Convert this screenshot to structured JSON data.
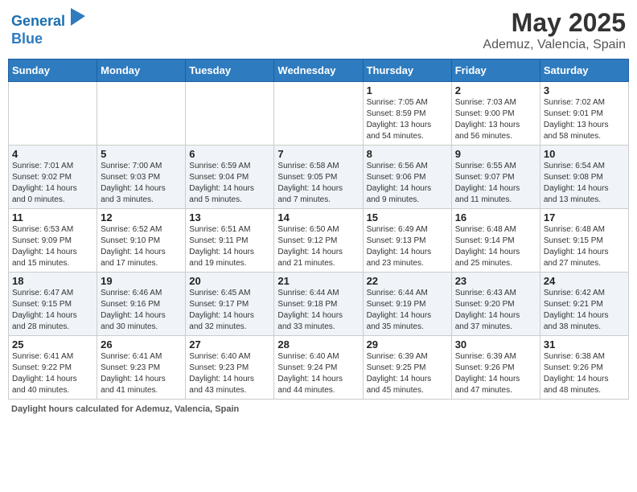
{
  "header": {
    "logo_line1": "General",
    "logo_line2": "Blue",
    "title": "May 2025",
    "subtitle": "Ademuz, Valencia, Spain"
  },
  "days_of_week": [
    "Sunday",
    "Monday",
    "Tuesday",
    "Wednesday",
    "Thursday",
    "Friday",
    "Saturday"
  ],
  "weeks": [
    [
      {
        "day": "",
        "info": ""
      },
      {
        "day": "",
        "info": ""
      },
      {
        "day": "",
        "info": ""
      },
      {
        "day": "",
        "info": ""
      },
      {
        "day": "1",
        "info": "Sunrise: 7:05 AM\nSunset: 8:59 PM\nDaylight: 13 hours\nand 54 minutes."
      },
      {
        "day": "2",
        "info": "Sunrise: 7:03 AM\nSunset: 9:00 PM\nDaylight: 13 hours\nand 56 minutes."
      },
      {
        "day": "3",
        "info": "Sunrise: 7:02 AM\nSunset: 9:01 PM\nDaylight: 13 hours\nand 58 minutes."
      }
    ],
    [
      {
        "day": "4",
        "info": "Sunrise: 7:01 AM\nSunset: 9:02 PM\nDaylight: 14 hours\nand 0 minutes."
      },
      {
        "day": "5",
        "info": "Sunrise: 7:00 AM\nSunset: 9:03 PM\nDaylight: 14 hours\nand 3 minutes."
      },
      {
        "day": "6",
        "info": "Sunrise: 6:59 AM\nSunset: 9:04 PM\nDaylight: 14 hours\nand 5 minutes."
      },
      {
        "day": "7",
        "info": "Sunrise: 6:58 AM\nSunset: 9:05 PM\nDaylight: 14 hours\nand 7 minutes."
      },
      {
        "day": "8",
        "info": "Sunrise: 6:56 AM\nSunset: 9:06 PM\nDaylight: 14 hours\nand 9 minutes."
      },
      {
        "day": "9",
        "info": "Sunrise: 6:55 AM\nSunset: 9:07 PM\nDaylight: 14 hours\nand 11 minutes."
      },
      {
        "day": "10",
        "info": "Sunrise: 6:54 AM\nSunset: 9:08 PM\nDaylight: 14 hours\nand 13 minutes."
      }
    ],
    [
      {
        "day": "11",
        "info": "Sunrise: 6:53 AM\nSunset: 9:09 PM\nDaylight: 14 hours\nand 15 minutes."
      },
      {
        "day": "12",
        "info": "Sunrise: 6:52 AM\nSunset: 9:10 PM\nDaylight: 14 hours\nand 17 minutes."
      },
      {
        "day": "13",
        "info": "Sunrise: 6:51 AM\nSunset: 9:11 PM\nDaylight: 14 hours\nand 19 minutes."
      },
      {
        "day": "14",
        "info": "Sunrise: 6:50 AM\nSunset: 9:12 PM\nDaylight: 14 hours\nand 21 minutes."
      },
      {
        "day": "15",
        "info": "Sunrise: 6:49 AM\nSunset: 9:13 PM\nDaylight: 14 hours\nand 23 minutes."
      },
      {
        "day": "16",
        "info": "Sunrise: 6:48 AM\nSunset: 9:14 PM\nDaylight: 14 hours\nand 25 minutes."
      },
      {
        "day": "17",
        "info": "Sunrise: 6:48 AM\nSunset: 9:15 PM\nDaylight: 14 hours\nand 27 minutes."
      }
    ],
    [
      {
        "day": "18",
        "info": "Sunrise: 6:47 AM\nSunset: 9:15 PM\nDaylight: 14 hours\nand 28 minutes."
      },
      {
        "day": "19",
        "info": "Sunrise: 6:46 AM\nSunset: 9:16 PM\nDaylight: 14 hours\nand 30 minutes."
      },
      {
        "day": "20",
        "info": "Sunrise: 6:45 AM\nSunset: 9:17 PM\nDaylight: 14 hours\nand 32 minutes."
      },
      {
        "day": "21",
        "info": "Sunrise: 6:44 AM\nSunset: 9:18 PM\nDaylight: 14 hours\nand 33 minutes."
      },
      {
        "day": "22",
        "info": "Sunrise: 6:44 AM\nSunset: 9:19 PM\nDaylight: 14 hours\nand 35 minutes."
      },
      {
        "day": "23",
        "info": "Sunrise: 6:43 AM\nSunset: 9:20 PM\nDaylight: 14 hours\nand 37 minutes."
      },
      {
        "day": "24",
        "info": "Sunrise: 6:42 AM\nSunset: 9:21 PM\nDaylight: 14 hours\nand 38 minutes."
      }
    ],
    [
      {
        "day": "25",
        "info": "Sunrise: 6:41 AM\nSunset: 9:22 PM\nDaylight: 14 hours\nand 40 minutes."
      },
      {
        "day": "26",
        "info": "Sunrise: 6:41 AM\nSunset: 9:23 PM\nDaylight: 14 hours\nand 41 minutes."
      },
      {
        "day": "27",
        "info": "Sunrise: 6:40 AM\nSunset: 9:23 PM\nDaylight: 14 hours\nand 43 minutes."
      },
      {
        "day": "28",
        "info": "Sunrise: 6:40 AM\nSunset: 9:24 PM\nDaylight: 14 hours\nand 44 minutes."
      },
      {
        "day": "29",
        "info": "Sunrise: 6:39 AM\nSunset: 9:25 PM\nDaylight: 14 hours\nand 45 minutes."
      },
      {
        "day": "30",
        "info": "Sunrise: 6:39 AM\nSunset: 9:26 PM\nDaylight: 14 hours\nand 47 minutes."
      },
      {
        "day": "31",
        "info": "Sunrise: 6:38 AM\nSunset: 9:26 PM\nDaylight: 14 hours\nand 48 minutes."
      }
    ]
  ],
  "footer": {
    "label": "Daylight hours",
    "description": "calculated for Ademuz, Valencia, Spain"
  }
}
